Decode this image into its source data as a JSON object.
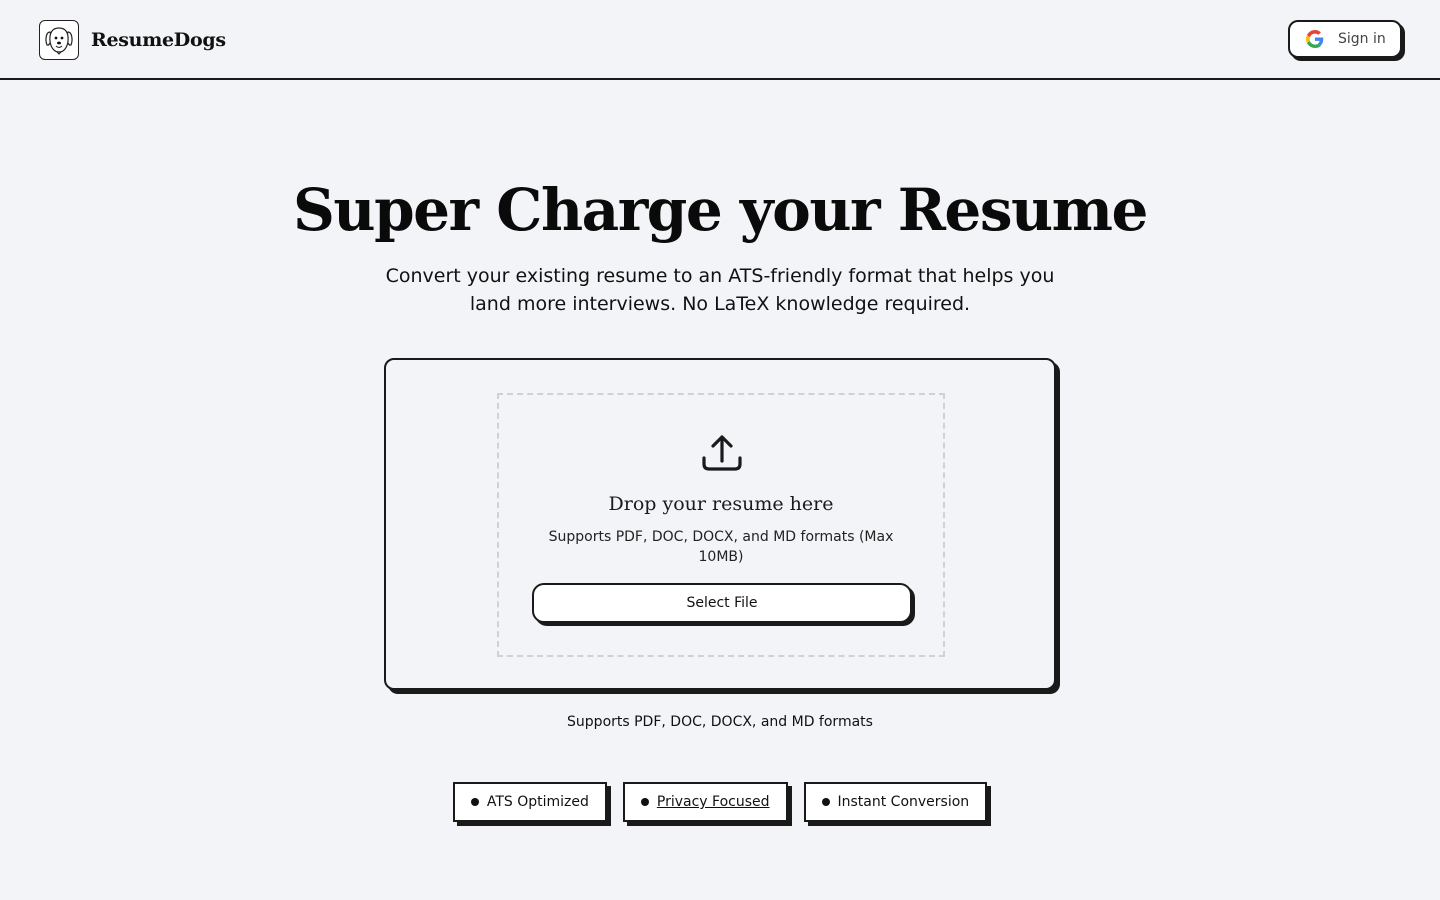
{
  "header": {
    "brand_name": "ResumeDogs",
    "logo_icon": "dog-logo-icon",
    "signin_label": "Sign in",
    "signin_icon": "google-icon"
  },
  "hero": {
    "title": "Super Charge your Resume",
    "subtitle": "Convert your existing resume to an ATS-friendly format that helps you land more interviews. No LaTeX knowledge required."
  },
  "upload": {
    "icon": "upload-icon",
    "title": "Drop your resume here",
    "formats": "Supports PDF, DOC, DOCX, and MD formats (Max 10MB)",
    "select_label": "Select File"
  },
  "formats_note": "Supports PDF, DOC, DOCX, and MD formats",
  "badges": [
    {
      "label": "ATS Optimized"
    },
    {
      "label": "Privacy Focused"
    },
    {
      "label": "Instant Conversion"
    }
  ],
  "colors": {
    "background": "#f3f4f8",
    "border": "#1a1a1a",
    "google_blue": "#4285F4",
    "google_red": "#EA4335",
    "google_yellow": "#FBBC05",
    "google_green": "#34A853"
  }
}
